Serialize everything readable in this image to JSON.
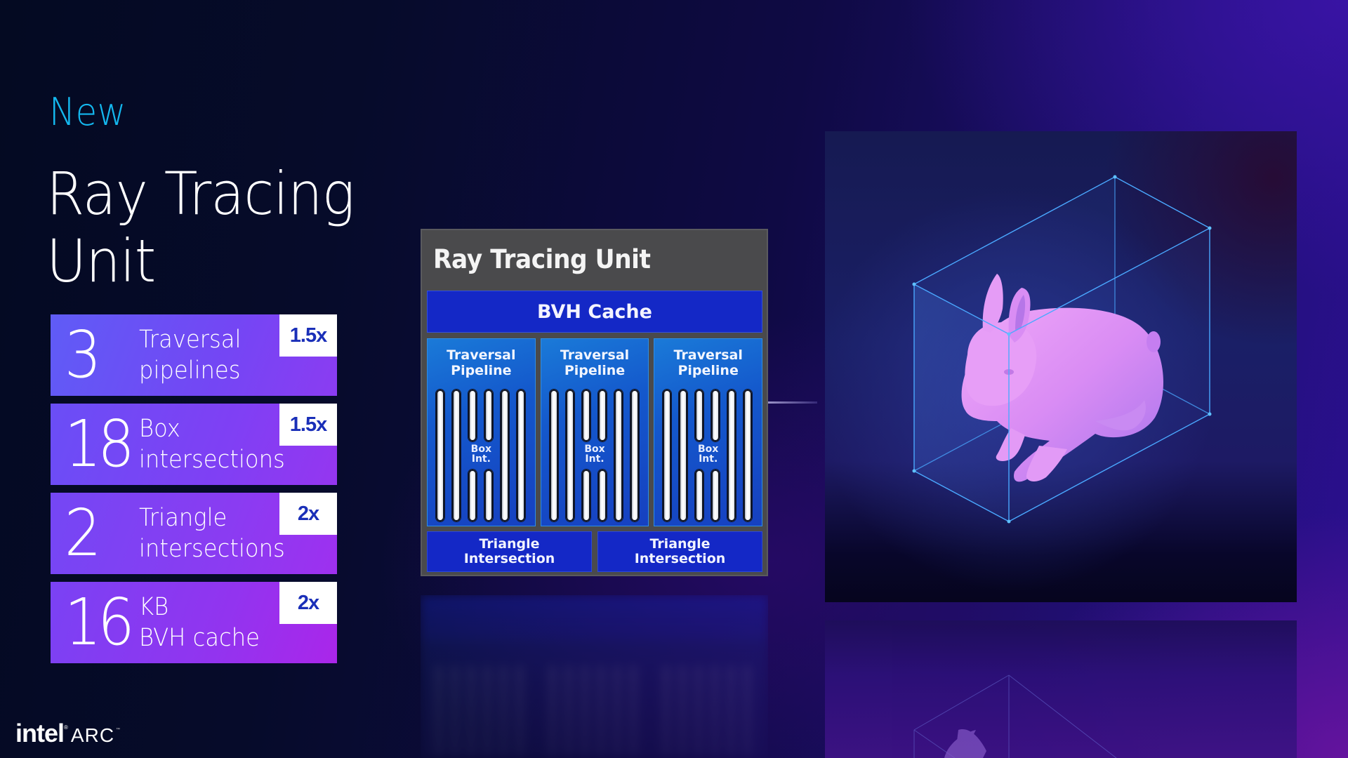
{
  "eyebrow": "New",
  "title": {
    "line1": "Ray Tracing",
    "line2": "Unit"
  },
  "stats": [
    {
      "value": "3",
      "label_line1": "Traversal",
      "label_line2": "pipelines",
      "badge": "1.5x"
    },
    {
      "value": "18",
      "label_line1": "Box",
      "label_line2": "intersections",
      "badge": "1.5x"
    },
    {
      "value": "2",
      "label_line1": "Triangle",
      "label_line2": "intersections",
      "badge": "2x"
    },
    {
      "value": "16",
      "label_line1": "KB",
      "label_line2": "BVH cache",
      "badge": "2x"
    }
  ],
  "diagram": {
    "title": "Ray Tracing Unit",
    "bvh_cache": "BVH Cache",
    "pipelines": [
      {
        "line1": "Traversal",
        "line2": "Pipeline",
        "box_line1": "Box",
        "box_line2": "Int."
      },
      {
        "line1": "Traversal",
        "line2": "Pipeline",
        "box_line1": "Box",
        "box_line2": "Int."
      },
      {
        "line1": "Traversal",
        "line2": "Pipeline",
        "box_line1": "Box",
        "box_line2": "Int."
      }
    ],
    "triangle_units": [
      {
        "line1": "Triangle",
        "line2": "Intersection"
      },
      {
        "line1": "Triangle",
        "line2": "Intersection"
      }
    ]
  },
  "illustration": {
    "subject": "bunny-in-bounding-box",
    "bunny_color": "#d78cf5",
    "box_line_color": "#4aa8ff"
  },
  "logo": {
    "brand": "intel",
    "product": "ARC"
  },
  "colors": {
    "accent_cyan": "#14b8ef",
    "badge_text": "#1a2fb8",
    "diagram_blue": "#1428c6",
    "diagram_gray": "#4a4a4c"
  }
}
